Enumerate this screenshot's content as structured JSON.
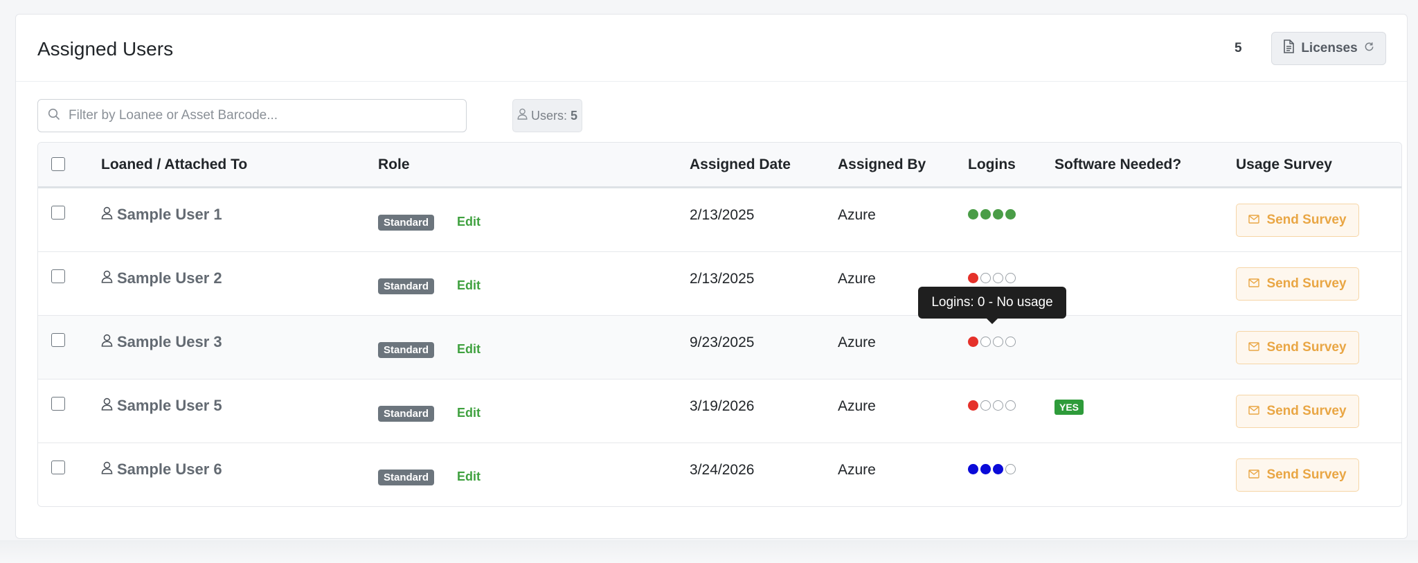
{
  "header": {
    "title": "Assigned Users",
    "count": "5",
    "licenses_label": "Licenses"
  },
  "filter": {
    "placeholder": "Filter by Loanee or Asset Barcode...",
    "value": "",
    "users_label": "Users:",
    "users_count": "5"
  },
  "table": {
    "columns": [
      "Loaned / Attached To",
      "Role",
      "Assigned Date",
      "Assigned By",
      "Logins",
      "Software Needed?",
      "Usage Survey"
    ],
    "edit_label": "Edit",
    "survey_label": "Send Survey",
    "rows": [
      {
        "user": "Sample User 1",
        "role": "Standard",
        "date": "2/13/2025",
        "by": "Azure",
        "logins": [
          1,
          1,
          1,
          1
        ],
        "login_color": "#4a9d47",
        "software": ""
      },
      {
        "user": "Sample User 2",
        "role": "Standard",
        "date": "2/13/2025",
        "by": "Azure",
        "logins": [
          1,
          0,
          0,
          0
        ],
        "login_color": "#e5312a",
        "software": ""
      },
      {
        "user": "Sample Uesr 3",
        "role": "Standard",
        "date": "9/23/2025",
        "by": "Azure",
        "logins": [
          1,
          0,
          0,
          0
        ],
        "login_color": "#e5312a",
        "software": ""
      },
      {
        "user": "Sample User 5",
        "role": "Standard",
        "date": "3/19/2026",
        "by": "Azure",
        "logins": [
          1,
          0,
          0,
          0
        ],
        "login_color": "#e5312a",
        "software": "YES"
      },
      {
        "user": "Sample User 6",
        "role": "Standard",
        "date": "3/24/2026",
        "by": "Azure",
        "logins": [
          1,
          1,
          1,
          0
        ],
        "login_color": "#0a0ad8",
        "software": ""
      }
    ]
  },
  "tooltip": {
    "text": "Logins: 0 - No usage"
  },
  "icons": {
    "search": "search-icon",
    "user": "user-icon",
    "document": "document-icon",
    "refresh": "refresh-icon",
    "mail": "mail-icon"
  },
  "colors": {
    "accent_green": "#3fa13f",
    "survey_orange": "#e9a644",
    "role_gray": "#6c757d"
  }
}
